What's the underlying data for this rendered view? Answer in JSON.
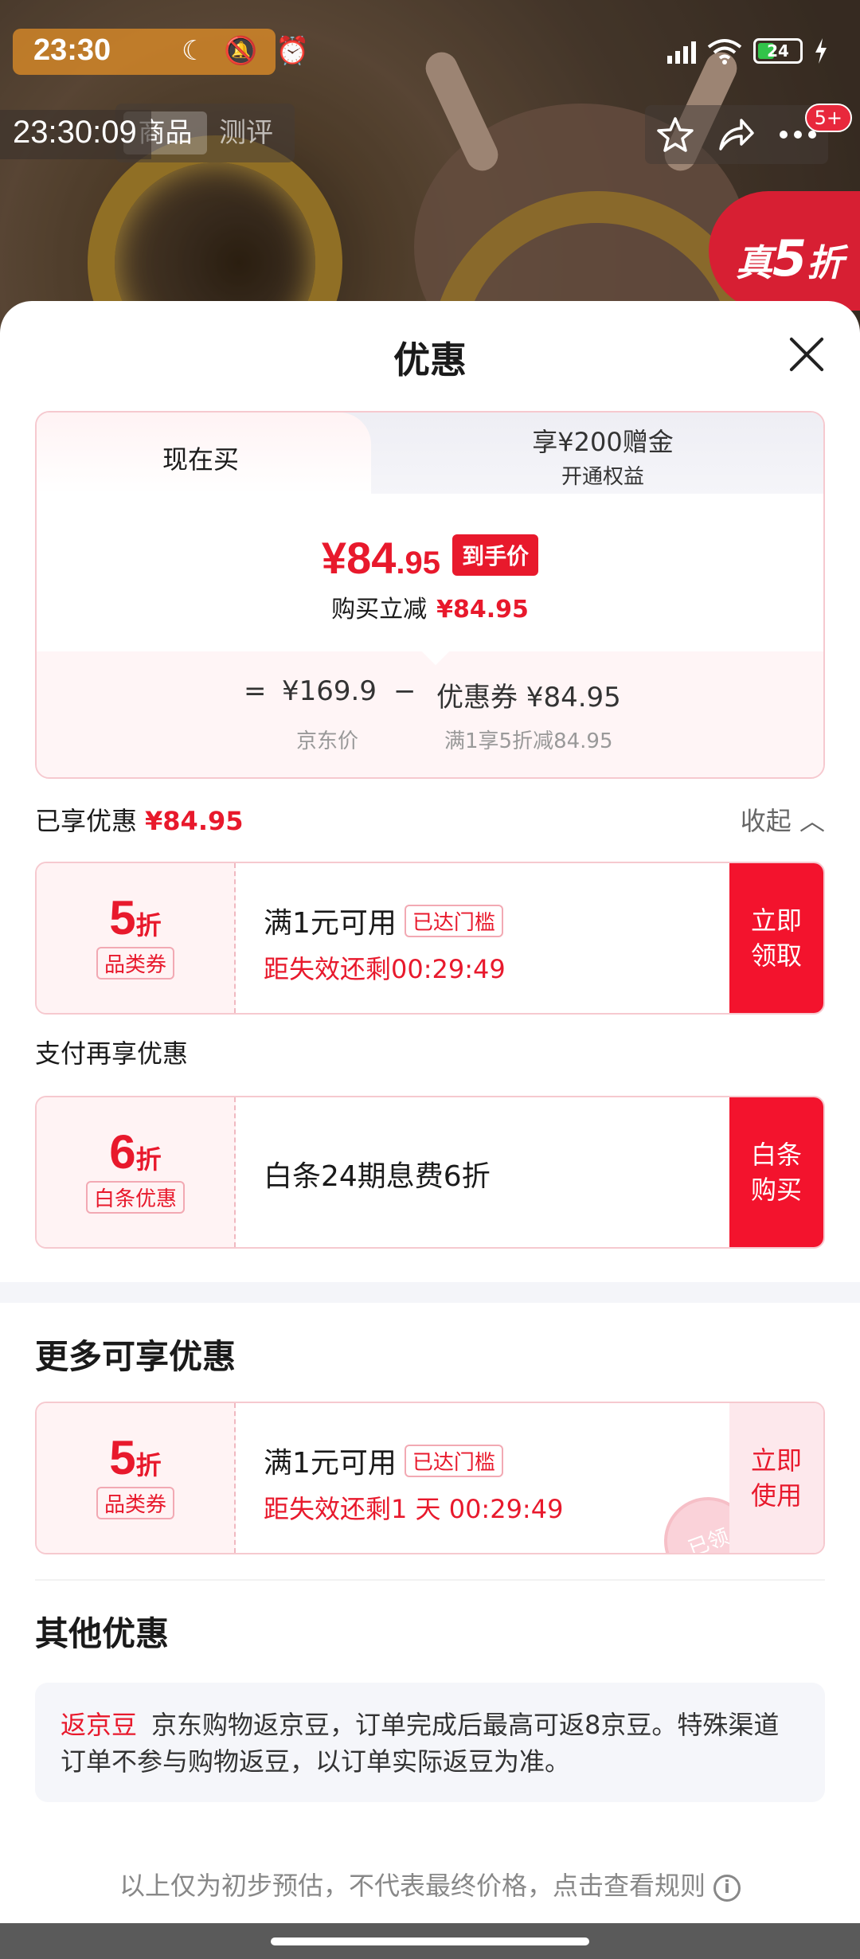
{
  "status_bar": {
    "time": "23:30",
    "mode_icons": "☾ 🔕 ⏰",
    "battery": "24"
  },
  "overlay_clock": "23:30:09",
  "product_nav": {
    "tabs": [
      "商品",
      "测评"
    ],
    "badge": "5+",
    "promo_prefix": "真",
    "promo_number": "5",
    "promo_suffix": "折"
  },
  "sheet": {
    "title": "优惠"
  },
  "price_card": {
    "tab_active": "现在买",
    "tab_other_line1": "享¥200赠金",
    "tab_other_line2": "开通权益",
    "final_price_int": "¥84",
    "final_price_dec": ".95",
    "final_tag": "到手价",
    "reduce_label": "购买立减",
    "reduce_value": "¥84.95",
    "calc": {
      "equals": "=",
      "jd_price": "¥169.9",
      "minus": "−",
      "coupon_label": "优惠券 ¥84.95",
      "jd_price_label": "京东价",
      "coupon_rule": "满1享5折减84.95"
    }
  },
  "enjoyed": {
    "label": "已享优惠",
    "value": "¥84.95",
    "collapse_label": "收起",
    "collapse_icon": "︿"
  },
  "coupon1": {
    "discount": "5",
    "unit": "折",
    "kind": "品类券",
    "condition": "满1元可用",
    "tag": "已达门槛",
    "countdown": "距失效还剩00:29:49",
    "button": "立即\n领取"
  },
  "pay_more_label": "支付再享优惠",
  "coupon2": {
    "discount": "6",
    "unit": "折",
    "kind": "白条优惠",
    "text": "白条24期息费6折",
    "button": "白条\n购买"
  },
  "more_section_title": "更多可享优惠",
  "coupon3": {
    "discount": "5",
    "unit": "折",
    "kind": "品类券",
    "condition": "满1元可用",
    "tag": "已达门槛",
    "countdown": "距失效还剩1 天 00:29:49",
    "button": "立即\n使用",
    "stamp": "已领"
  },
  "other_section_title": "其他优惠",
  "other_info": {
    "label": "返京豆",
    "text": "京东购物返京豆，订单完成后最高可返8京豆。特殊渠道订单不参与购物返豆，以订单实际返豆为准。"
  },
  "disclaimer": "以上仅为初步预估，不代表最终价格，点击查看规则",
  "colors": {
    "accent_red": "#e8192c",
    "button_red": "#f3132d",
    "card_border": "#f6c9cf"
  }
}
